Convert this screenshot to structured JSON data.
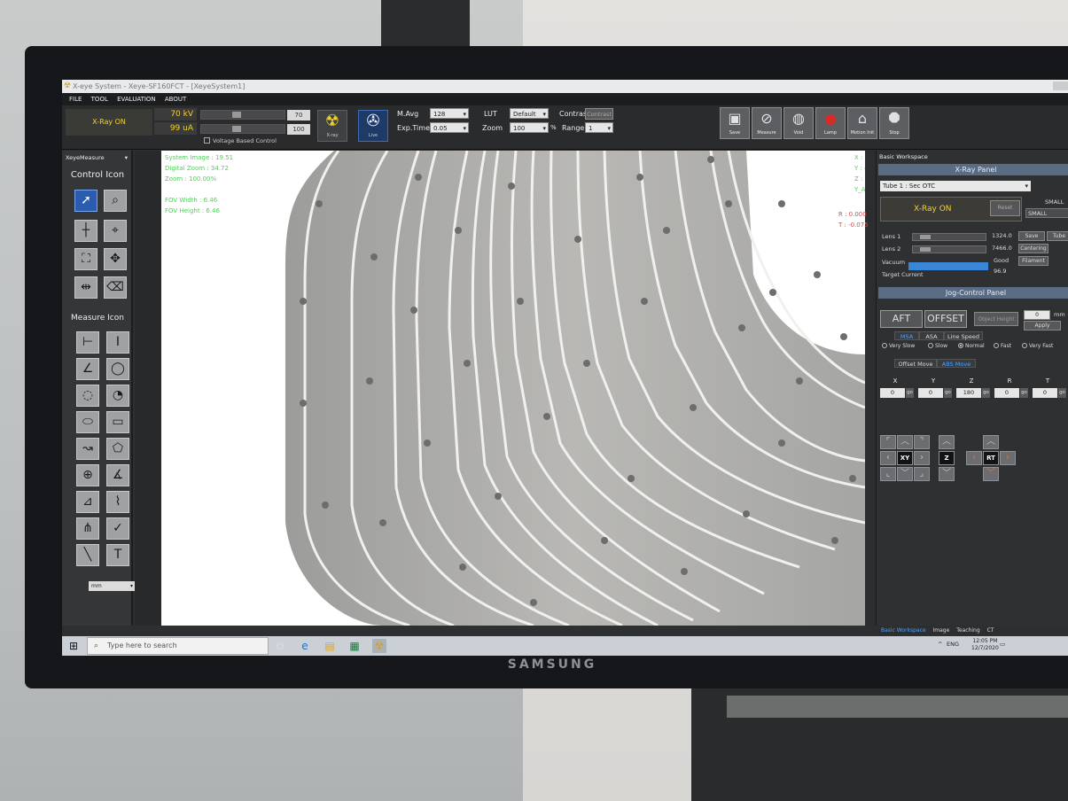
{
  "window": {
    "title": "X-eye System - Xeye-SF160FCT - [XeyeSystem1]",
    "menu": [
      "FILE",
      "TOOL",
      "EVALUATION",
      "ABOUT"
    ]
  },
  "toolbar": {
    "xray_status": "X-Ray ON",
    "kv": "70 kV",
    "ua": "99 uA",
    "kv_value": "70",
    "ua_value": "100",
    "kv_slider_level": 0.42,
    "ua_slider_level": 0.42,
    "voltage_based_control": "Voltage Based Control",
    "xray_button": "X-ray",
    "live_button": "Live",
    "mavg_label": "M.Avg",
    "mavg_value": "128",
    "exptime_label": "Exp.Time",
    "exptime_value": "0.05",
    "lut_label": "LUT",
    "lut_value": "Default",
    "zoom_label": "Zoom",
    "zoom_value": "100",
    "zoom_unit": "%",
    "contrast_label": "Contrast",
    "contrast_button": "Contrast",
    "range_label": "Range",
    "range_value": "1",
    "tools": [
      {
        "label": "Save",
        "icon": "floppy-icon"
      },
      {
        "label": "Measure",
        "icon": "measure-icon"
      },
      {
        "label": "Void",
        "icon": "void-icon"
      },
      {
        "label": "Lamp",
        "icon": "lamp-icon"
      },
      {
        "label": "Motion Init",
        "icon": "home-icon"
      },
      {
        "label": "Stop",
        "icon": "stop-icon"
      }
    ]
  },
  "left_panel": {
    "dropdown": "XeyeMeasure",
    "control_title": "Control Icon",
    "measure_title": "Measure Icon",
    "unit": "mm"
  },
  "viewport": {
    "overlay_left": [
      "System Image : 19.51",
      "Digital Zoom : 34.72",
      "Zoom : 100.00%",
      "FOV Width : 6.46",
      "FOV Height : 6.46"
    ],
    "overlay_right_green": [
      "X : 126.496",
      "Y : 406.785",
      "Z : 176.254",
      "Y_AFT : 0.000"
    ],
    "overlay_right_red": [
      "R : 0.000",
      "T : -0.075"
    ]
  },
  "right_panel": {
    "workspace": "Basic Workspace",
    "xray_panel_title": "X-Ray Panel",
    "tube": "Tube 1 : Sec OTC",
    "xray_on": "X-Ray ON",
    "reset": "Reset",
    "small_label": "SMALL",
    "small_value": "SMALL",
    "lens1_label": "Lens 1",
    "lens1_value": "1324.0",
    "lens2_label": "Lens 2",
    "lens2_value": "7466.0",
    "vacuum_label": "Vacuum",
    "vacuum_value": "Good",
    "vacuum_level": 0.9,
    "target_label": "Target Current",
    "target_value": "96.9",
    "save_btn": "Save",
    "centering_btn": "Centering",
    "filament_btn": "Filament",
    "tube_btn": "Tube",
    "jog_title": "Jog-Control Panel",
    "aft": "AFT",
    "offset": "OFFSET",
    "object_height": "Object Height",
    "height_value": "0",
    "height_unit": "mm",
    "apply": "Apply",
    "speed_tabs": [
      "MSA",
      "ASA",
      "Line Speed"
    ],
    "speeds": [
      "Very Slow",
      "Slow",
      "Normal",
      "Fast",
      "Very Fast"
    ],
    "selected_speed": "Normal",
    "move_tabs": [
      "Offset Move",
      "ABS Move"
    ],
    "axes": [
      {
        "name": "X",
        "value": "0"
      },
      {
        "name": "Y",
        "value": "0"
      },
      {
        "name": "Z",
        "value": "180"
      },
      {
        "name": "R",
        "value": "0"
      },
      {
        "name": "T",
        "value": "0"
      }
    ],
    "go_label": "go",
    "jog_xy": "XY",
    "jog_z": "Z",
    "jog_rt": "RT"
  },
  "bottom_tabs": [
    "Basic Workspace",
    "Image",
    "Teaching",
    "CT"
  ],
  "taskbar": {
    "search_placeholder": "Type here to search",
    "lang": "ENG",
    "time": "12:05 PM",
    "date": "12/7/2020"
  },
  "monitor": {
    "brand": "SAMSUNG"
  }
}
